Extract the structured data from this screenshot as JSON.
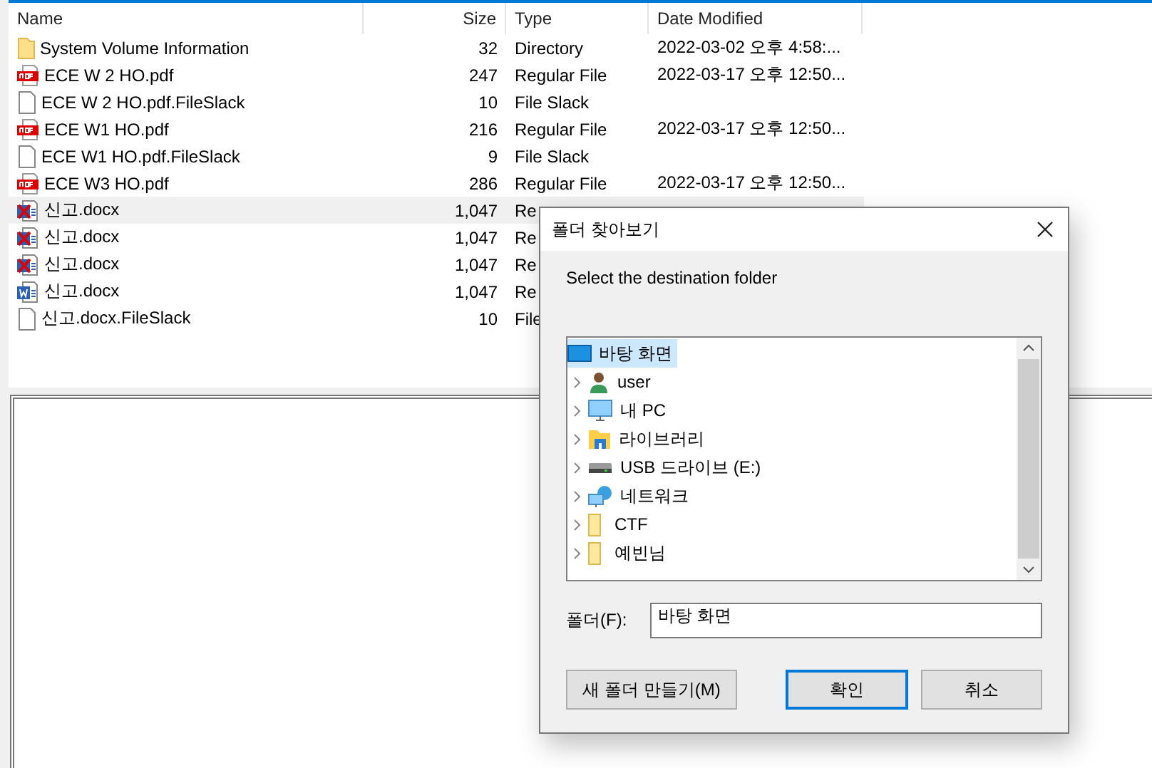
{
  "file_list": {
    "columns": [
      "Name",
      "Size",
      "Type",
      "Date Modified"
    ],
    "rows": [
      {
        "kind": "folder",
        "name": "System Volume Information",
        "size": "32",
        "type": "Directory",
        "date": "2022-03-02 오후 4:58:...",
        "selected": false
      },
      {
        "kind": "pdf",
        "name": "ECE W 2 HO.pdf",
        "size": "247",
        "type": "Regular File",
        "date": "2022-03-17 오후 12:50...",
        "selected": false
      },
      {
        "kind": "file",
        "name": "ECE W 2 HO.pdf.FileSlack",
        "size": "10",
        "type": "File Slack",
        "selected": false
      },
      {
        "kind": "pdf",
        "name": "ECE W1 HO.pdf",
        "size": "216",
        "type": "Regular File",
        "date": "2022-03-17 오후 12:50...",
        "selected": false
      },
      {
        "kind": "file",
        "name": "ECE W1 HO.pdf.FileSlack",
        "size": "9",
        "type": "File Slack",
        "selected": false
      },
      {
        "kind": "pdf",
        "name": "ECE W3 HO.pdf",
        "size": "286",
        "type": "Regular File",
        "date": "2022-03-17 오후 12:50...",
        "selected": false
      },
      {
        "kind": "docx_deleted",
        "name": "신고.docx",
        "size": "1,047",
        "type": "Re",
        "selected": true
      },
      {
        "kind": "docx_deleted",
        "name": "신고.docx",
        "size": "1,047",
        "type": "Re",
        "selected": false
      },
      {
        "kind": "docx_deleted",
        "name": "신고.docx",
        "size": "1,047",
        "type": "Re",
        "selected": false
      },
      {
        "kind": "docx",
        "name": "신고.docx",
        "size": "1,047",
        "type": "Re",
        "selected": false
      },
      {
        "kind": "file",
        "name": "신고.docx.FileSlack",
        "size": "10",
        "type": "File",
        "selected": false
      }
    ]
  },
  "dialog": {
    "title": "폴더 찾아보기",
    "prompt": "Select the destination folder",
    "tree": [
      {
        "kind": "desktop",
        "label": "바탕 화면",
        "selected": true,
        "expandable": false
      },
      {
        "kind": "user",
        "label": "user",
        "selected": false,
        "expandable": true
      },
      {
        "kind": "pc",
        "label": "내 PC",
        "selected": false,
        "expandable": true
      },
      {
        "kind": "library",
        "label": "라이브러리",
        "selected": false,
        "expandable": true
      },
      {
        "kind": "drive",
        "label": "USB 드라이브 (E:)",
        "selected": false,
        "expandable": true
      },
      {
        "kind": "network",
        "label": "네트워크",
        "selected": false,
        "expandable": true
      },
      {
        "kind": "folder",
        "label": "CTF",
        "selected": false,
        "expandable": true
      },
      {
        "kind": "folder",
        "label": "예빈님",
        "selected": false,
        "expandable": true
      }
    ],
    "folder_label": "폴더(F):",
    "folder_value": "바탕 화면",
    "buttons": [
      {
        "label": "새 폴더 만들기(M)",
        "default": false
      },
      {
        "label": "확인",
        "default": true
      },
      {
        "label": "취소",
        "default": false
      }
    ]
  }
}
